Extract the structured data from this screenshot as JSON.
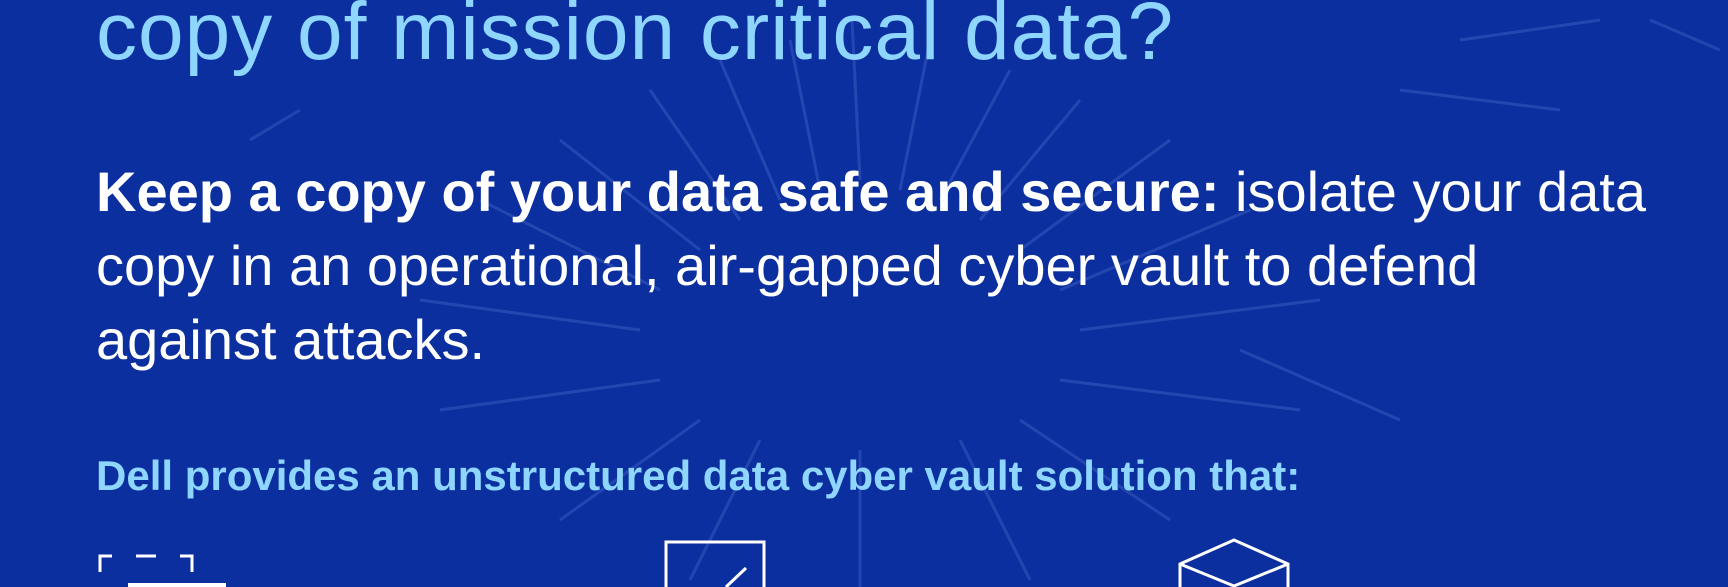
{
  "heading": "copy of mission critical data?",
  "body": {
    "bold_lead": "Keep a copy of your data safe and secure:",
    "rest": " isolate your data copy in an operational, air-gapped cyber vault to defend against attacks."
  },
  "sub_heading": "Dell provides an unstructured data cyber vault solution that:",
  "icons": [
    "scan-frame-icon",
    "edit-square-icon",
    "cube-icon"
  ],
  "colors": {
    "background": "#0c2fa0",
    "accent": "#8fd6ff",
    "text": "#ffffff"
  }
}
